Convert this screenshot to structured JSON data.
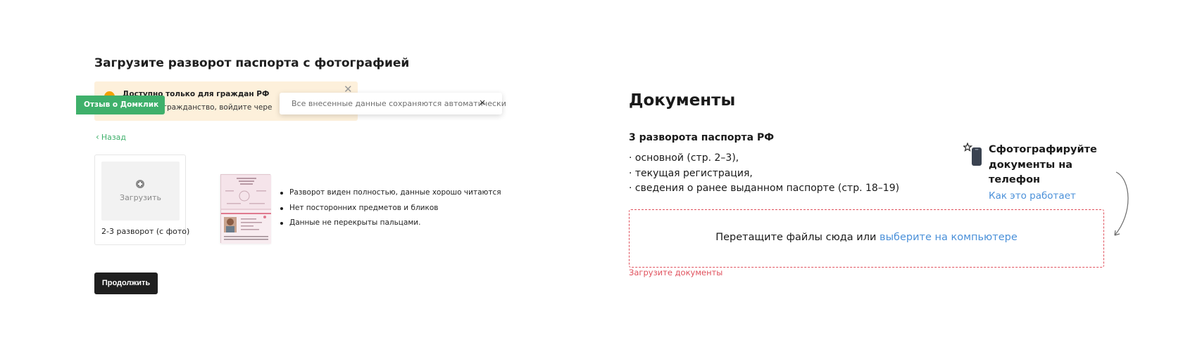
{
  "left": {
    "title": "Загрузите разворот паспорта с фотографией",
    "notice": {
      "title": "Доступно только для граждан РФ",
      "text": "ас другое гражданство, войдите чере",
      "close_icon": "close-icon"
    },
    "feedback_tab": "Отзыв о Домклик",
    "toast": {
      "text": "Все внесенные данные сохраняются автоматически",
      "close": "×"
    },
    "back_link": "Назад",
    "upload_card": {
      "upload_label": "Загрузить",
      "caption": "2-3 разворот (с фото)"
    },
    "tips": [
      "Разворот виден полностью, данные хорошо читаются",
      "Нет посторонних предметов и бликов",
      "Данные не перекрыты пальцами."
    ],
    "continue_button": "Продолжить"
  },
  "right": {
    "title": "Документы",
    "subtitle": "3 разворота паспорта РФ",
    "items": [
      "· основной (стр. 2–3),",
      "· текущая регистрация,",
      "· сведения о ранее выданном паспорте (стр. 18–19)"
    ],
    "phone_block": {
      "title": "Сфотографируйте документы на телефон",
      "link": "Как это работает"
    },
    "dropzone": {
      "text": "Перетащите файлы сюда или ",
      "link": "выберите на компьютере"
    },
    "error": "Загрузите документы"
  },
  "colors": {
    "accent_green": "#3fb06b",
    "link_blue": "#4a90d9",
    "error_red": "#e0515d",
    "notice_bg": "#fdf0db",
    "notice_icon": "#f2a100",
    "button_dark": "#1f1f1f"
  }
}
